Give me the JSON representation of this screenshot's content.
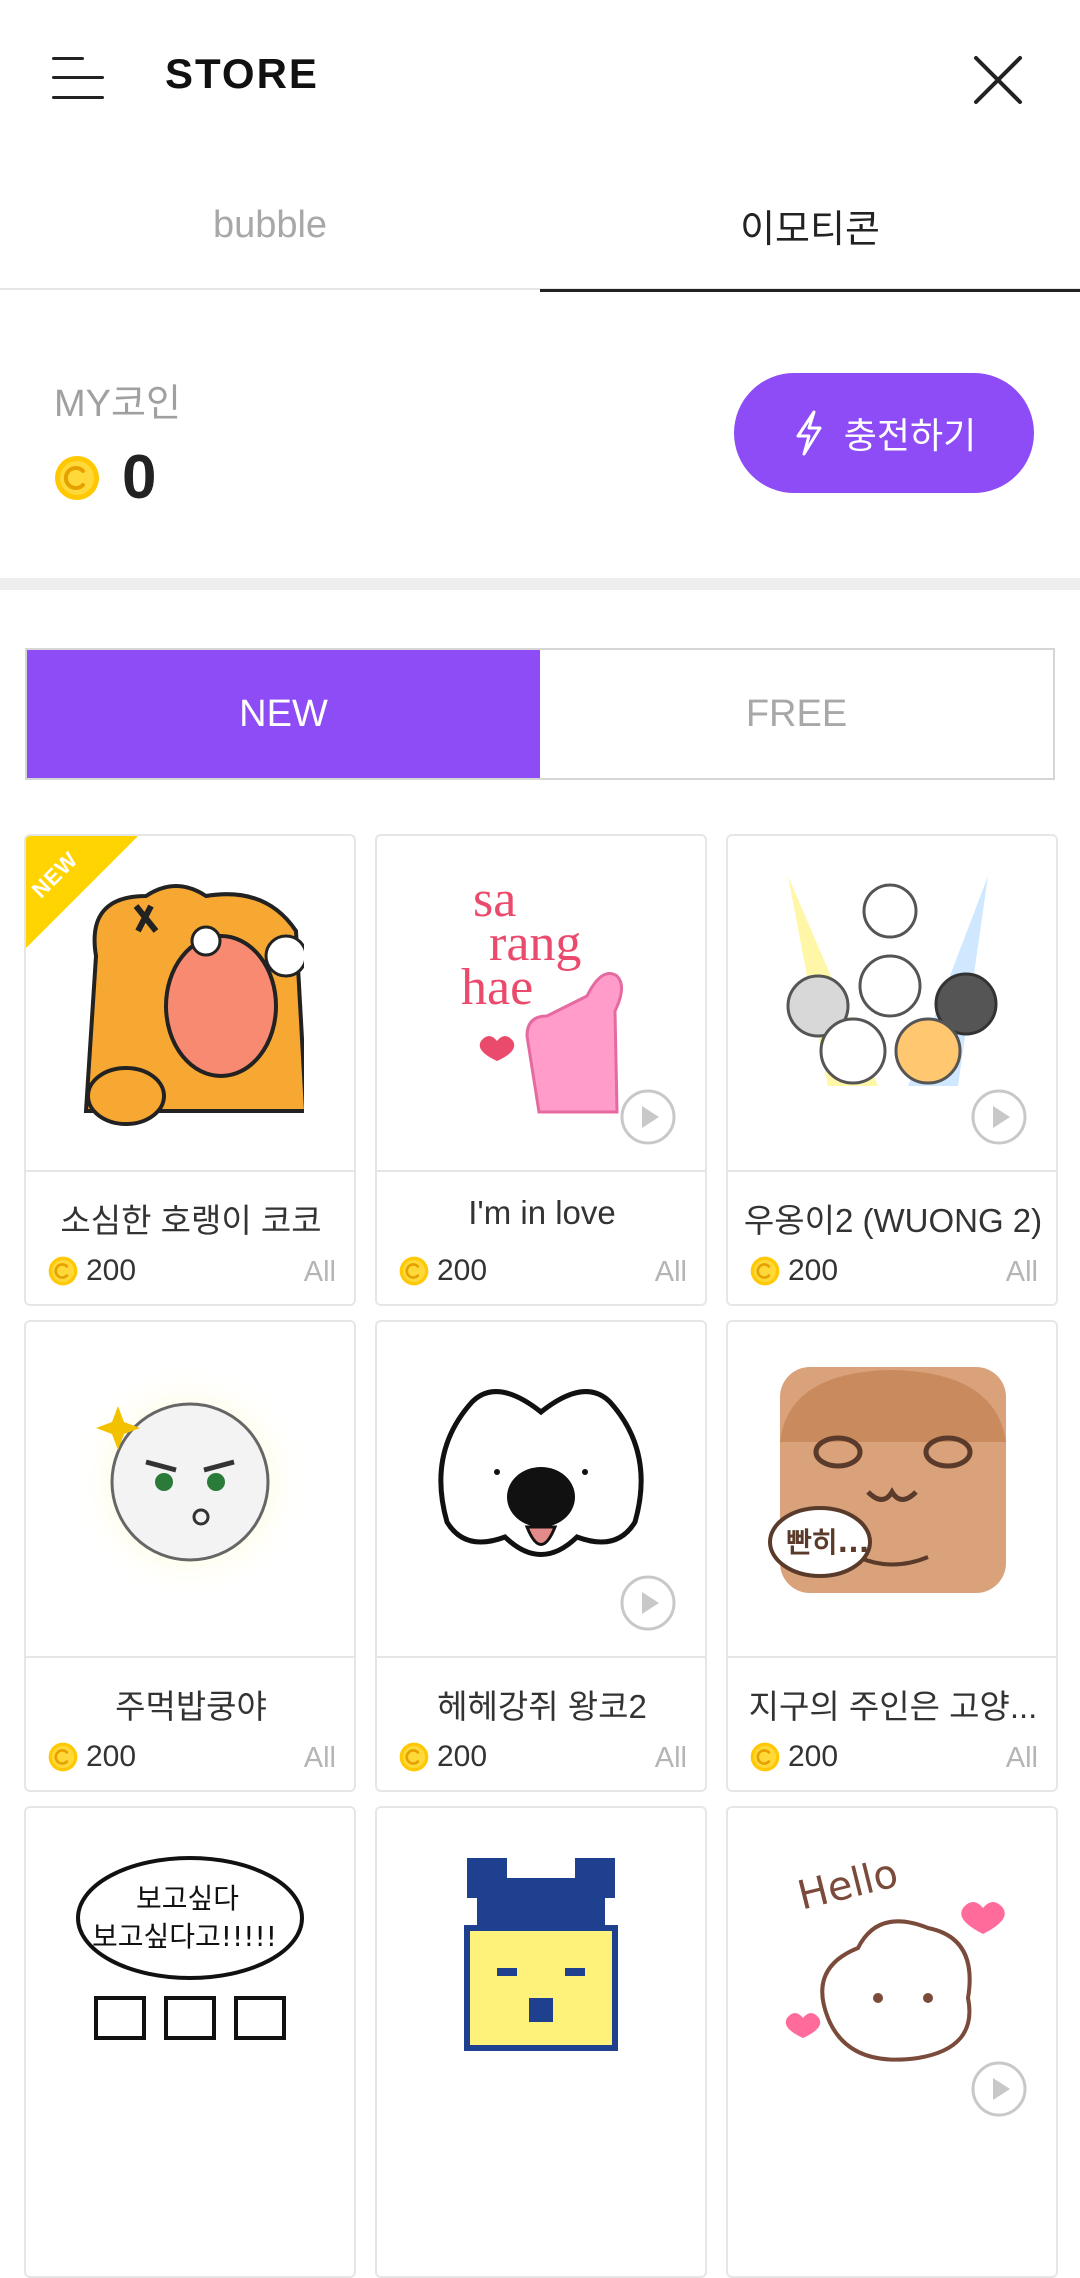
{
  "header": {
    "title": "STORE"
  },
  "tabs": [
    {
      "label": "bubble",
      "active": false
    },
    {
      "label": "이모티콘",
      "active": true
    }
  ],
  "coins": {
    "label": "MY코인",
    "value": "0",
    "charge_label": "충전하기"
  },
  "segment": [
    {
      "label": "NEW",
      "active": true
    },
    {
      "label": "FREE",
      "active": false
    }
  ],
  "new_badge": "NEW",
  "items": [
    {
      "name": "소심한 호랭이 코코",
      "price": "200",
      "tag": "All",
      "is_new": true,
      "animated": false
    },
    {
      "name": "I'm in love",
      "price": "200",
      "tag": "All",
      "is_new": false,
      "animated": true,
      "art_text": [
        "sa",
        "rang",
        "hae"
      ]
    },
    {
      "name": "우옹이2 (WUONG 2)",
      "price": "200",
      "tag": "All",
      "is_new": false,
      "animated": true
    },
    {
      "name": "주먹밥쿵야",
      "price": "200",
      "tag": "All",
      "is_new": false,
      "animated": false
    },
    {
      "name": "헤헤강쥐 왕코2",
      "price": "200",
      "tag": "All",
      "is_new": false,
      "animated": true
    },
    {
      "name": "지구의 주인은 고양...",
      "price": "200",
      "tag": "All",
      "is_new": false,
      "animated": false,
      "art_text": [
        "빤히..."
      ]
    },
    {
      "name": "",
      "price": "",
      "tag": "",
      "is_new": false,
      "animated": false,
      "art_text": [
        "보고싶다",
        "보고싶다고!!!!!"
      ]
    },
    {
      "name": "",
      "price": "",
      "tag": "",
      "is_new": false,
      "animated": false
    },
    {
      "name": "",
      "price": "",
      "tag": "",
      "is_new": false,
      "animated": true,
      "art_text": [
        "Hello"
      ]
    }
  ],
  "colors": {
    "accent": "#8d4cf5",
    "coin": "#ffc800",
    "ribbon": "#ffd400"
  },
  "icons": {
    "menu": "menu-icon",
    "close": "close-icon",
    "charge": "lightning-icon",
    "coin": "coin-icon",
    "play": "play-icon"
  }
}
